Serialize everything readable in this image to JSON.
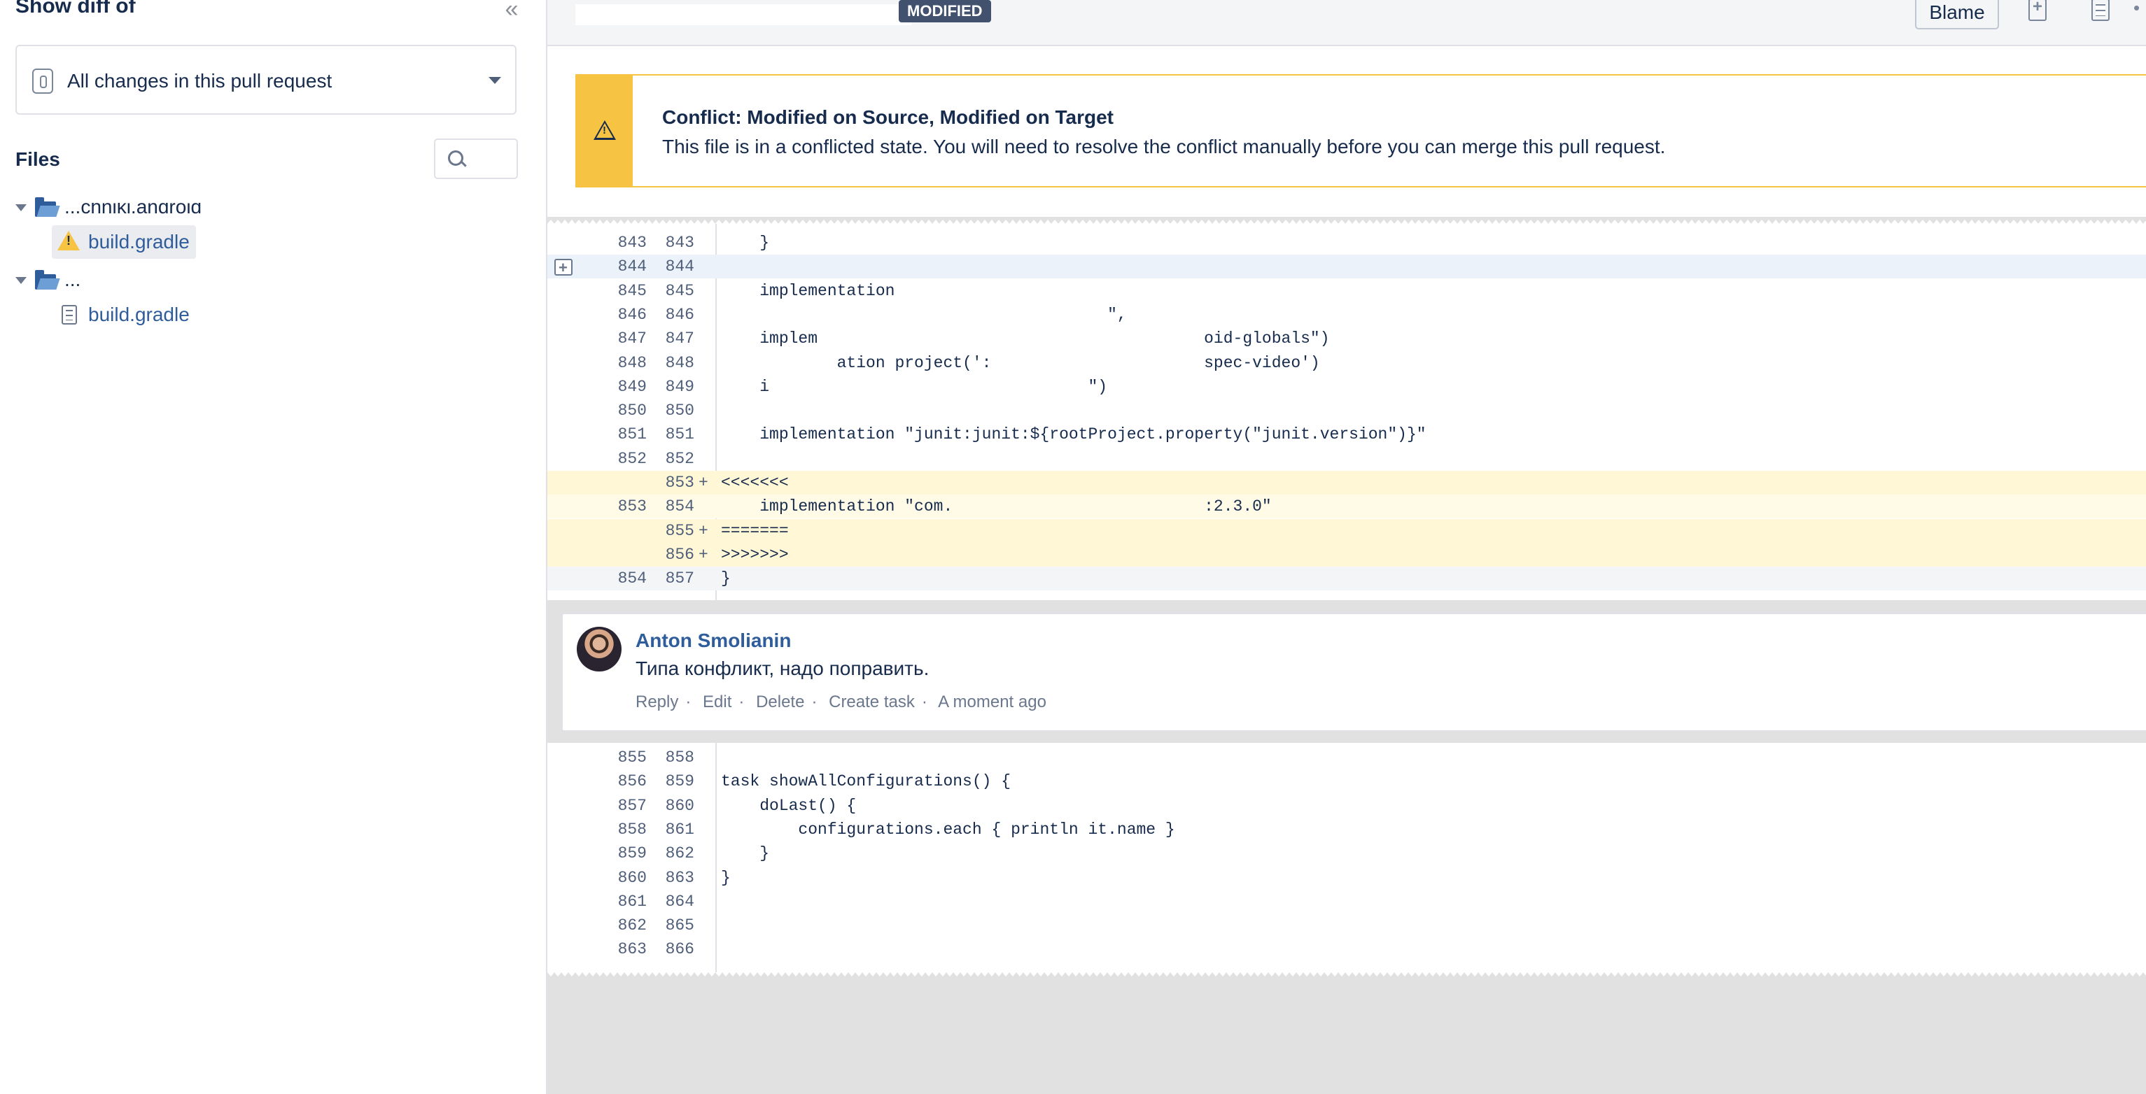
{
  "sidebar": {
    "title": "Show diff of",
    "diff_select": {
      "label": "All changes in this pull request"
    },
    "files_label": "Files",
    "tree": [
      {
        "folder": "...chniki.android",
        "files": [
          {
            "name": "build.gradle",
            "status": "conflict",
            "icon": "warning-icon"
          }
        ]
      },
      {
        "folder": "...",
        "files": [
          {
            "name": "build.gradle",
            "status": "normal",
            "icon": "document-icon"
          }
        ]
      }
    ]
  },
  "file_header": {
    "status_badge": "MODIFIED",
    "blame_label": "Blame"
  },
  "conflict": {
    "title": "Conflict: Modified on Source, Modified on Target",
    "message": "This file is in a conflicted state. You will need to resolve the conflict manually before you can merge this pull request."
  },
  "diff_top": [
    {
      "old": "843",
      "new": "843",
      "marker": "",
      "code": "    }",
      "type": "context"
    },
    {
      "old": "844",
      "new": "844",
      "marker": "",
      "code": "",
      "type": "hover"
    },
    {
      "old": "845",
      "new": "845",
      "marker": "",
      "code": "    implementation ",
      "type": "context"
    },
    {
      "old": "846",
      "new": "846",
      "marker": "",
      "code": "                                        \",",
      "type": "context"
    },
    {
      "old": "847",
      "new": "847",
      "marker": "",
      "code": "    implem                                        oid-globals\")",
      "type": "context"
    },
    {
      "old": "848",
      "new": "848",
      "marker": "",
      "code": "            ation project(':                      spec-video')",
      "type": "context"
    },
    {
      "old": "849",
      "new": "849",
      "marker": "",
      "code": "    i                                 \")",
      "type": "context"
    },
    {
      "old": "850",
      "new": "850",
      "marker": "",
      "code": "",
      "type": "context"
    },
    {
      "old": "851",
      "new": "851",
      "marker": "",
      "code": "    implementation \"junit:junit:${rootProject.property(\"junit.version\")}\"",
      "type": "context"
    },
    {
      "old": "852",
      "new": "852",
      "marker": "",
      "code": "",
      "type": "context"
    },
    {
      "old": "",
      "new": "853",
      "marker": "+",
      "code": "<<<<<<<",
      "type": "added"
    },
    {
      "old": "853",
      "new": "854",
      "marker": "",
      "code": "    implementation \"com.                          :2.3.0\"",
      "type": "context-conf"
    },
    {
      "old": "",
      "new": "855",
      "marker": "+",
      "code": "=======",
      "type": "added"
    },
    {
      "old": "",
      "new": "856",
      "marker": "+",
      "code": ">>>>>>>",
      "type": "added"
    },
    {
      "old": "854",
      "new": "857",
      "marker": "",
      "code": "}",
      "type": "last"
    }
  ],
  "comment": {
    "author": "Anton Smolianin",
    "text": "Типа конфликт, надо поправить.",
    "actions": [
      "Reply",
      "Edit",
      "Delete",
      "Create task"
    ],
    "timestamp": "A moment ago"
  },
  "diff_bottom": [
    {
      "old": "855",
      "new": "858",
      "marker": "",
      "code": ""
    },
    {
      "old": "856",
      "new": "859",
      "marker": "",
      "code": "task showAllConfigurations() {"
    },
    {
      "old": "857",
      "new": "860",
      "marker": "",
      "code": "    doLast() {"
    },
    {
      "old": "858",
      "new": "861",
      "marker": "",
      "code": "        configurations.each { println it.name }"
    },
    {
      "old": "859",
      "new": "862",
      "marker": "",
      "code": "    }"
    },
    {
      "old": "860",
      "new": "863",
      "marker": "",
      "code": "}"
    },
    {
      "old": "861",
      "new": "864",
      "marker": "",
      "code": ""
    },
    {
      "old": "862",
      "new": "865",
      "marker": "",
      "code": ""
    },
    {
      "old": "863",
      "new": "866",
      "marker": "",
      "code": ""
    }
  ],
  "colors": {
    "conflict_accent": "#f6c342",
    "link": "#2f5d9c",
    "badge": "#42526e",
    "added_row": "#fff7d6"
  }
}
